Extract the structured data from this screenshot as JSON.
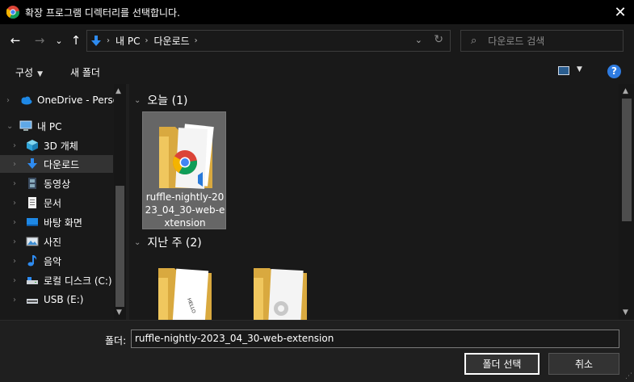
{
  "window": {
    "title": "확장 프로그램 디렉터리를 선택합니다.",
    "close_glyph": "✕"
  },
  "nav": {
    "back_glyph": "←",
    "forward_glyph": "→",
    "recent_glyph": "⌄",
    "up_glyph": "↑",
    "breadcrumbs": [
      "내 PC",
      "다운로드"
    ],
    "refresh_glyph": "↻",
    "search_placeholder": "다운로드 검색"
  },
  "toolbar": {
    "organize_label": "구성",
    "new_folder_label": "새 폴더",
    "help_glyph": "?"
  },
  "sidebar": {
    "items": [
      {
        "label": "OneDrive - Person",
        "icon": "cloud-icon"
      },
      {
        "label": "내 PC",
        "icon": "pc-icon",
        "expanded": true
      },
      {
        "label": "3D 개체",
        "icon": "cube-icon"
      },
      {
        "label": "다운로드",
        "icon": "download-icon",
        "selected": true
      },
      {
        "label": "동영상",
        "icon": "video-icon"
      },
      {
        "label": "문서",
        "icon": "document-icon"
      },
      {
        "label": "바탕 화면",
        "icon": "desktop-icon"
      },
      {
        "label": "사진",
        "icon": "pictures-icon"
      },
      {
        "label": "음악",
        "icon": "music-icon"
      },
      {
        "label": "로컬 디스크 (C:)",
        "icon": "drive-icon"
      },
      {
        "label": "USB (E:)",
        "icon": "usb-drive-icon"
      }
    ]
  },
  "content": {
    "groups": [
      {
        "label": "오늘 (1)"
      },
      {
        "label": "지난 주 (2)"
      }
    ],
    "today_item": {
      "name": "ruffle-nightly-2023_04_30-web-extension"
    }
  },
  "footer": {
    "folder_label": "폴더:",
    "folder_value": "ruffle-nightly-2023_04_30-web-extension",
    "select_label": "폴더 선택",
    "cancel_label": "취소"
  },
  "colors": {
    "background": "#191919",
    "accent": "#2e7be0",
    "folder": "#e8c069"
  }
}
